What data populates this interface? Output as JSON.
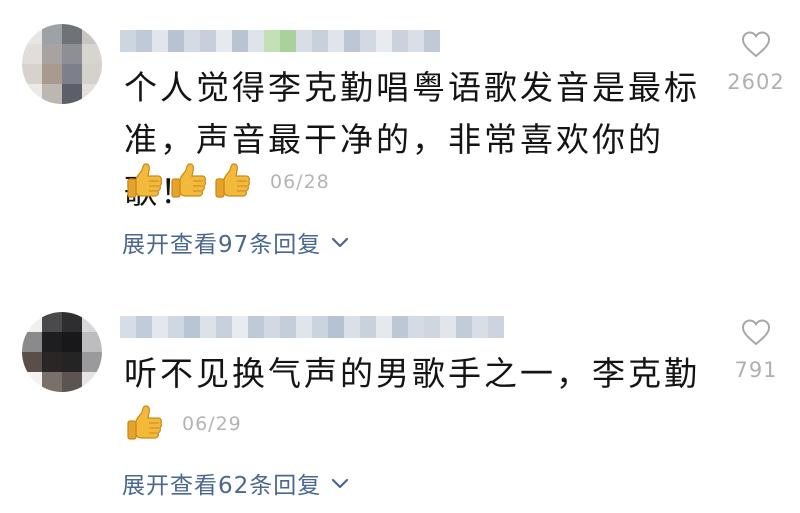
{
  "comments": [
    {
      "text_line1": "个人觉得李克勤唱粤语歌发音是最标",
      "text_line2": "准，声音最干净的，非常喜欢你的歌！",
      "reactions": [
        "thumbs-up",
        "thumbs-up",
        "thumbs-up"
      ],
      "date": "06/28",
      "like_count": "2602",
      "replies_label": "展开查看97条回复",
      "avatar_colors": [
        [
          "#e8e6e3",
          "#9ea2a6",
          "#6f7378",
          "#c9c6c2"
        ],
        [
          "#e0ddda",
          "#a8a2a0",
          "#8d8f94",
          "#d8d4d0"
        ],
        [
          "#d8d2cc",
          "#a99a8f",
          "#7d7f8a",
          "#d5d1cd"
        ],
        [
          "#ece9e6",
          "#bdb7b1",
          "#5a5f68",
          "#e3e0dc"
        ]
      ],
      "username_colors": [
        "#cdd5e0",
        "#bfc9d8",
        "#e2e6ec",
        "#b7c3d3",
        "#d5dbe4",
        "#c6cfdb",
        "#e6e9ee",
        "#b9c4d2",
        "#dfe3ea",
        "#c3e0b8",
        "#a9d19a",
        "#d9dee6",
        "#c8d0dc",
        "#e1e5eb",
        "#bcc6d4",
        "#d3d9e2",
        "#e8ebef",
        "#cbd2dd",
        "#dadfe7",
        "#c0cad7"
      ]
    },
    {
      "text_line1": "听不见换气声的男歌手之一，李克勤",
      "reactions": [
        "thumbs-up"
      ],
      "date": "06/29",
      "like_count": "791",
      "replies_label": "展开查看62条回复",
      "avatar_colors": [
        [
          "#f0efee",
          "#4a4a4c",
          "#2e2e30",
          "#d8d8da"
        ],
        [
          "#8a8a8c",
          "#1e1e20",
          "#18181a",
          "#bdbdbf"
        ],
        [
          "#5a4e48",
          "#2a2626",
          "#242424",
          "#9a9a9c"
        ],
        [
          "#f3f2f1",
          "#7a706a",
          "#5c5450",
          "#e6e5e4"
        ]
      ],
      "username_colors": [
        "#d6dde6",
        "#c1ccda",
        "#e4e8ee",
        "#cfd7e2",
        "#b8c5d5",
        "#dde2e9",
        "#c7d0dc",
        "#e8ebf0",
        "#bfcad8",
        "#d2d9e3",
        "#c4cedb",
        "#e0e4eb",
        "#cbd3de",
        "#b5c2d3",
        "#dbe0e8",
        "#c9d1dd",
        "#e5e8ed",
        "#bdc8d6",
        "#d4dbe4",
        "#cfd6e0",
        "#e2e6ec",
        "#c2ccd9",
        "#d8dee6",
        "#cdd4df"
      ]
    }
  ],
  "colors": {
    "text": "#141414",
    "meta": "#b4b4b4",
    "link": "#4a6791",
    "like_icon": "#a8a8a8"
  },
  "icons": {
    "like": "heart-outline-icon",
    "expand": "chevron-down-icon",
    "reaction": "thumbs-up-emoji"
  }
}
